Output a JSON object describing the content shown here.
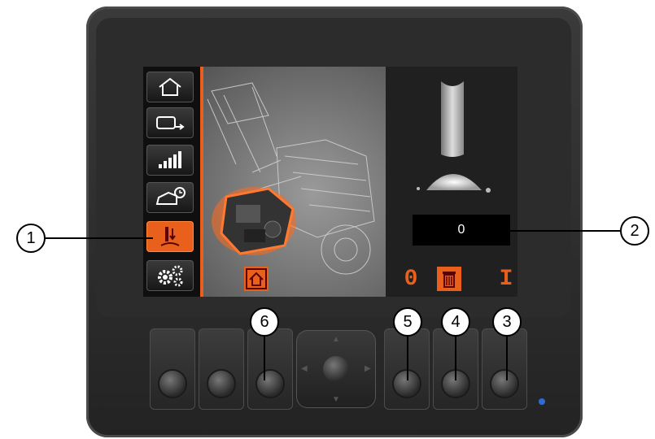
{
  "screen": {
    "value_display": "0",
    "colors": {
      "accent": "#e8601c",
      "screen_bg": "#1a1a1a",
      "value_bg": "#000000"
    }
  },
  "sidebar": {
    "items": [
      {
        "icon": "home-icon"
      },
      {
        "icon": "machine-transfer-icon"
      },
      {
        "icon": "signal-bars-icon"
      },
      {
        "icon": "machine-timer-icon"
      },
      {
        "icon": "lubrication-icon",
        "active": true
      },
      {
        "icon": "settings-gears-icon"
      }
    ]
  },
  "softkeys": {
    "home": "home-icon",
    "zero": "0",
    "delete": "trash-icon",
    "one": "I"
  },
  "callouts": [
    "1",
    "2",
    "3",
    "4",
    "5",
    "6"
  ]
}
